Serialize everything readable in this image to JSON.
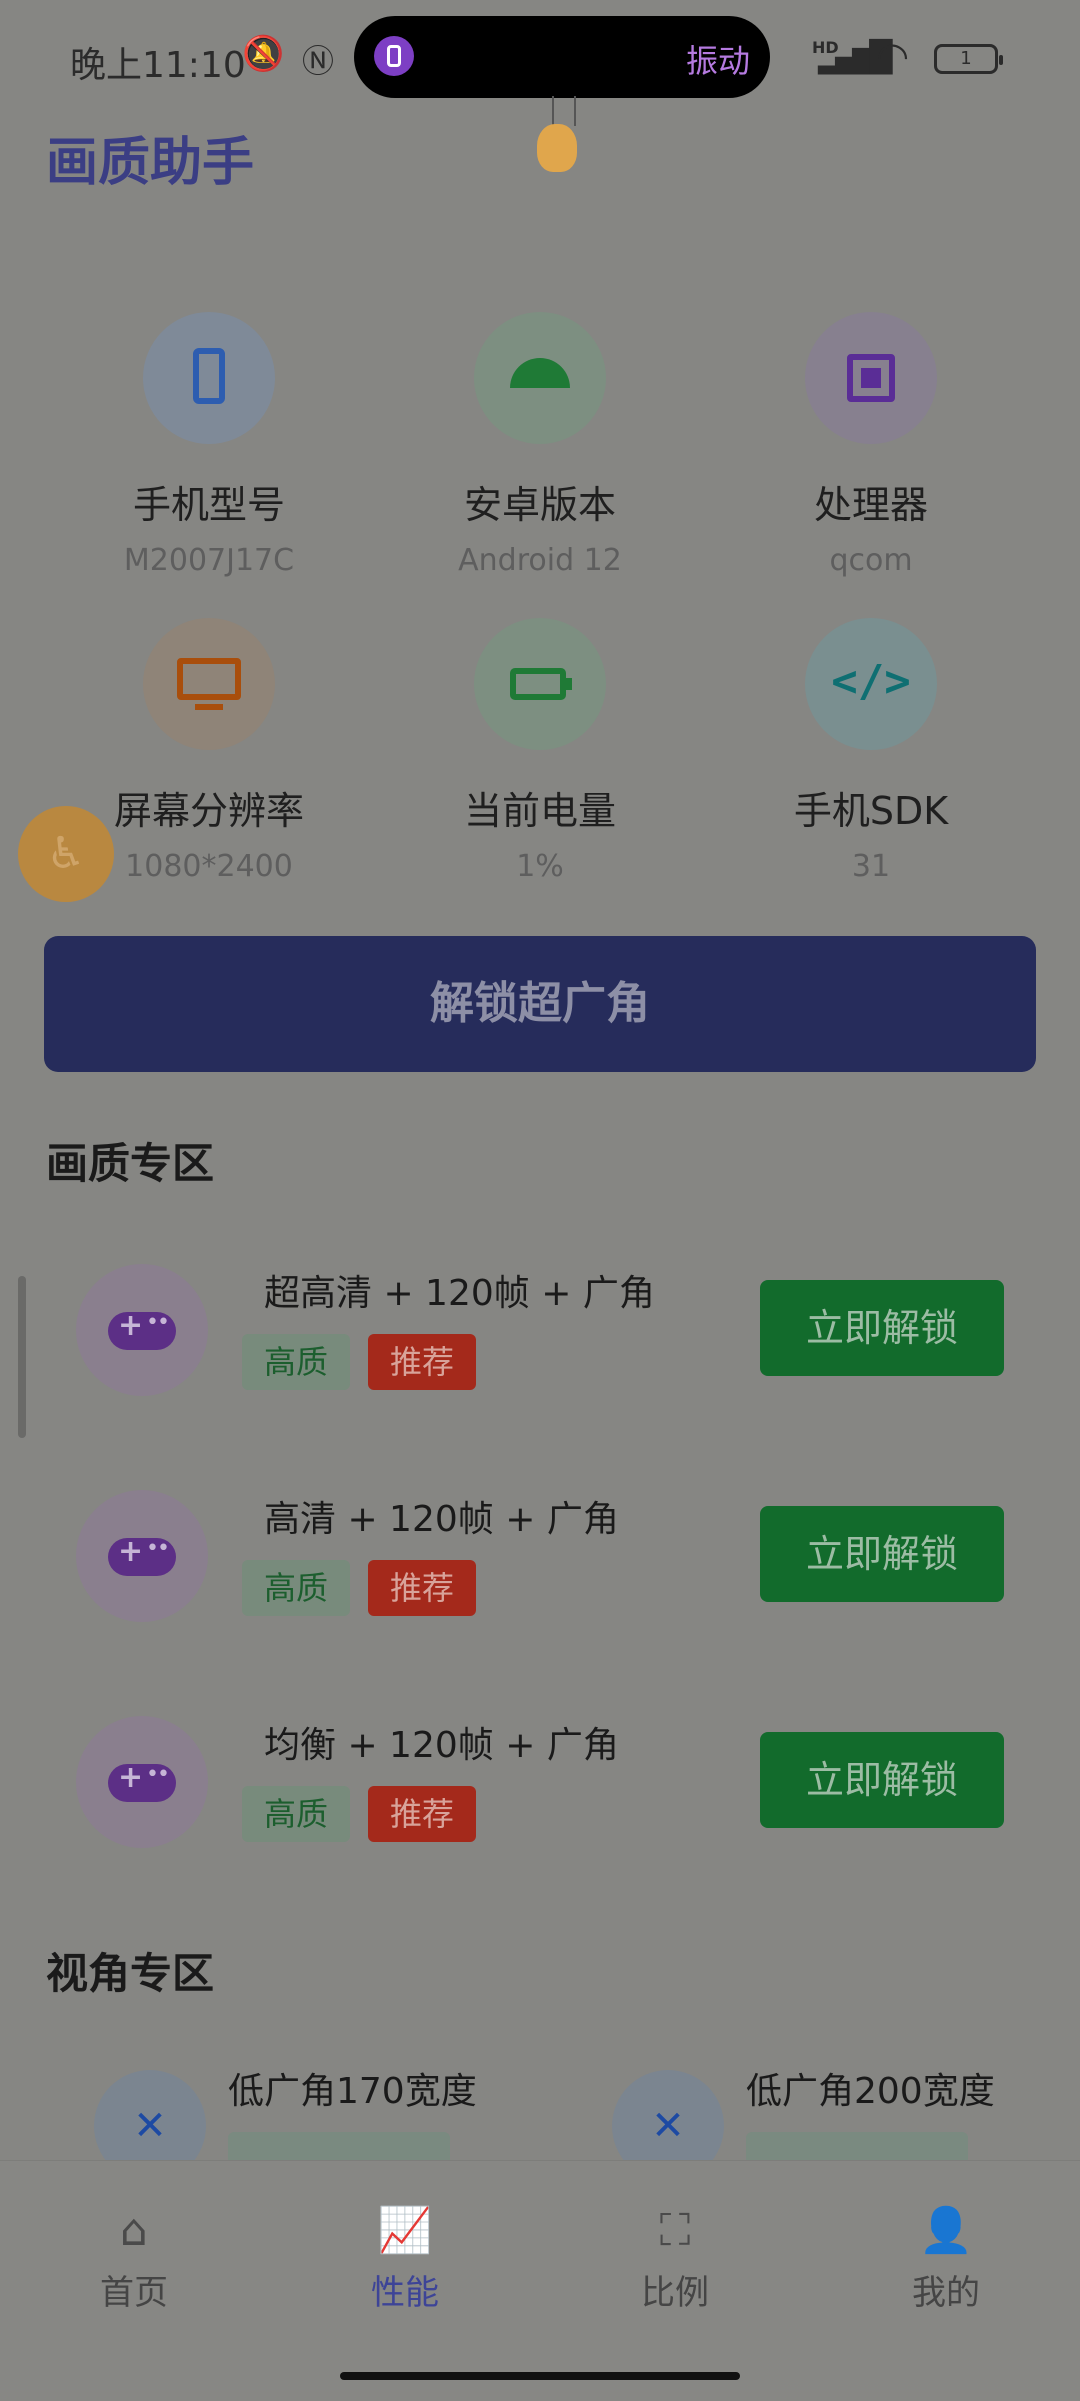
{
  "status_bar": {
    "time": "晚上11:10",
    "island_label": "振动",
    "battery_level": "1",
    "signal_label": "HD"
  },
  "header": {
    "title": "画质助手"
  },
  "device_info": [
    {
      "label": "手机型号",
      "value": "M2007J17C",
      "icon": "phone-icon",
      "color": "#3f6fb0"
    },
    {
      "label": "安卓版本",
      "value": "Android 12",
      "icon": "android-icon",
      "color": "#2e8a42"
    },
    {
      "label": "处理器",
      "value": "qcom",
      "icon": "chip-icon",
      "color": "#6c3fa8"
    },
    {
      "label": "屏幕分辨率",
      "value": "1080*2400",
      "icon": "monitor-icon",
      "color": "#c2580d"
    },
    {
      "label": "当前电量",
      "value": "1%",
      "icon": "battery-icon",
      "color": "#2e8a42"
    },
    {
      "label": "手机SDK",
      "value": "31",
      "icon": "code-icon",
      "color": "#128b8c"
    }
  ],
  "unlock_wide_button": "解锁超广角",
  "quality_section": {
    "title": "画质专区",
    "items": [
      {
        "title": "超高清 + 120帧 + 广角",
        "tag1": "高质",
        "tag2": "推荐",
        "button": "立即解锁"
      },
      {
        "title": "高清 + 120帧 + 广角",
        "tag1": "高质",
        "tag2": "推荐",
        "button": "立即解锁"
      },
      {
        "title": "均衡 + 120帧 + 广角",
        "tag1": "高质",
        "tag2": "推荐",
        "button": "立即解锁"
      }
    ]
  },
  "view_section": {
    "title": "视角专区",
    "items": [
      {
        "title": "低广角170宽度"
      },
      {
        "title": "低广角200宽度"
      }
    ]
  },
  "bottom_nav": [
    {
      "label": "首页",
      "icon": "home-icon",
      "active": false
    },
    {
      "label": "性能",
      "icon": "chart-icon",
      "active": true
    },
    {
      "label": "比例",
      "icon": "fullscreen-icon",
      "active": false
    },
    {
      "label": "我的",
      "icon": "person-icon",
      "active": false
    }
  ]
}
